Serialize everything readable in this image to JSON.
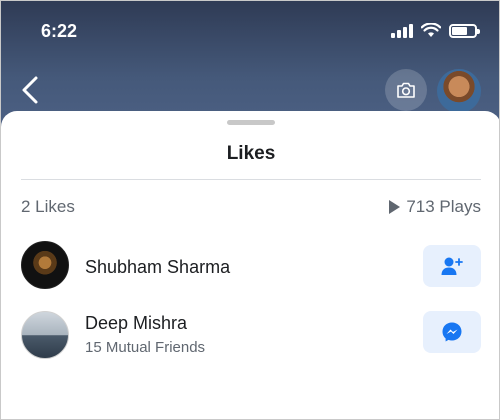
{
  "status_bar": {
    "time": "6:22"
  },
  "header": {
    "back_icon": "chevron-left-icon",
    "camera_icon": "camera-icon"
  },
  "sheet": {
    "title": "Likes",
    "likes_count": "2 Likes",
    "plays": "713 Plays"
  },
  "people": [
    {
      "name": "Shubham Sharma",
      "subtitle": "",
      "action_icon": "add-friend-icon"
    },
    {
      "name": "Deep Mishra",
      "subtitle": "15 Mutual Friends",
      "action_icon": "messenger-icon"
    }
  ],
  "colors": {
    "accent": "#1877f2",
    "action_bg": "#e7f0fd"
  }
}
